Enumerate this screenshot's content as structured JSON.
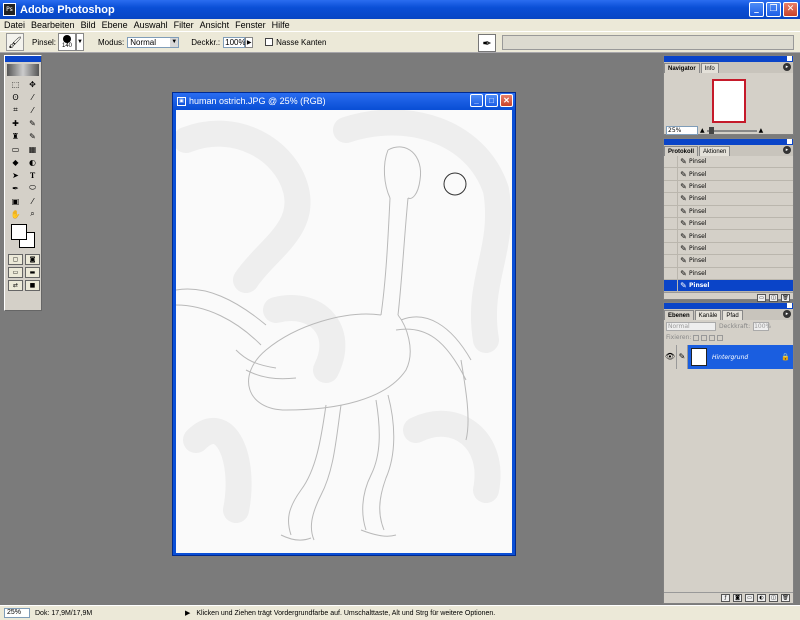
{
  "window": {
    "title": "Adobe Photoshop",
    "app_icon": "Ps"
  },
  "menu": [
    "Datei",
    "Bearbeiten",
    "Bild",
    "Ebene",
    "Auswahl",
    "Filter",
    "Ansicht",
    "Fenster",
    "Hilfe"
  ],
  "options": {
    "brush_label": "Pinsel:",
    "brush_size": "140",
    "mode_label": "Modus:",
    "mode_value": "Normal",
    "opacity_label": "Deckkr.:",
    "opacity_value": "100%",
    "wet_edges_label": "Nasse Kanten"
  },
  "document": {
    "title": "human ostrich.JPG @ 25% (RGB)"
  },
  "navigator": {
    "tabs": [
      "Navigator",
      "Info"
    ],
    "zoom": "25%"
  },
  "history": {
    "tabs": [
      "Protokoll",
      "Aktionen"
    ],
    "items": [
      "Pinsel",
      "Pinsel",
      "Pinsel",
      "Pinsel",
      "Pinsel",
      "Pinsel",
      "Pinsel",
      "Pinsel",
      "Pinsel",
      "Pinsel",
      "Pinsel"
    ],
    "active_index": 10
  },
  "layers": {
    "tabs": [
      "Ebenen",
      "Kanäle",
      "Pfad"
    ],
    "blend_mode": "Normal",
    "opacity_label": "Deckkraft:",
    "opacity_value": "100%",
    "lock_label": "Fixieren:",
    "layer_name": "Hintergrund"
  },
  "status": {
    "zoom": "25%",
    "doc_info": "Dok: 17,9M/17,9M",
    "hint": "Klicken und Ziehen trägt Vordergrundfarbe auf. Umschalttaste, Alt und Strg für weitere Optionen."
  },
  "colors": {
    "titlebar": "#0a4fd6",
    "chrome": "#ece9d8",
    "workspace": "#7b7b7b",
    "palette": "#d4d0c8",
    "highlight": "#0a44c8"
  }
}
